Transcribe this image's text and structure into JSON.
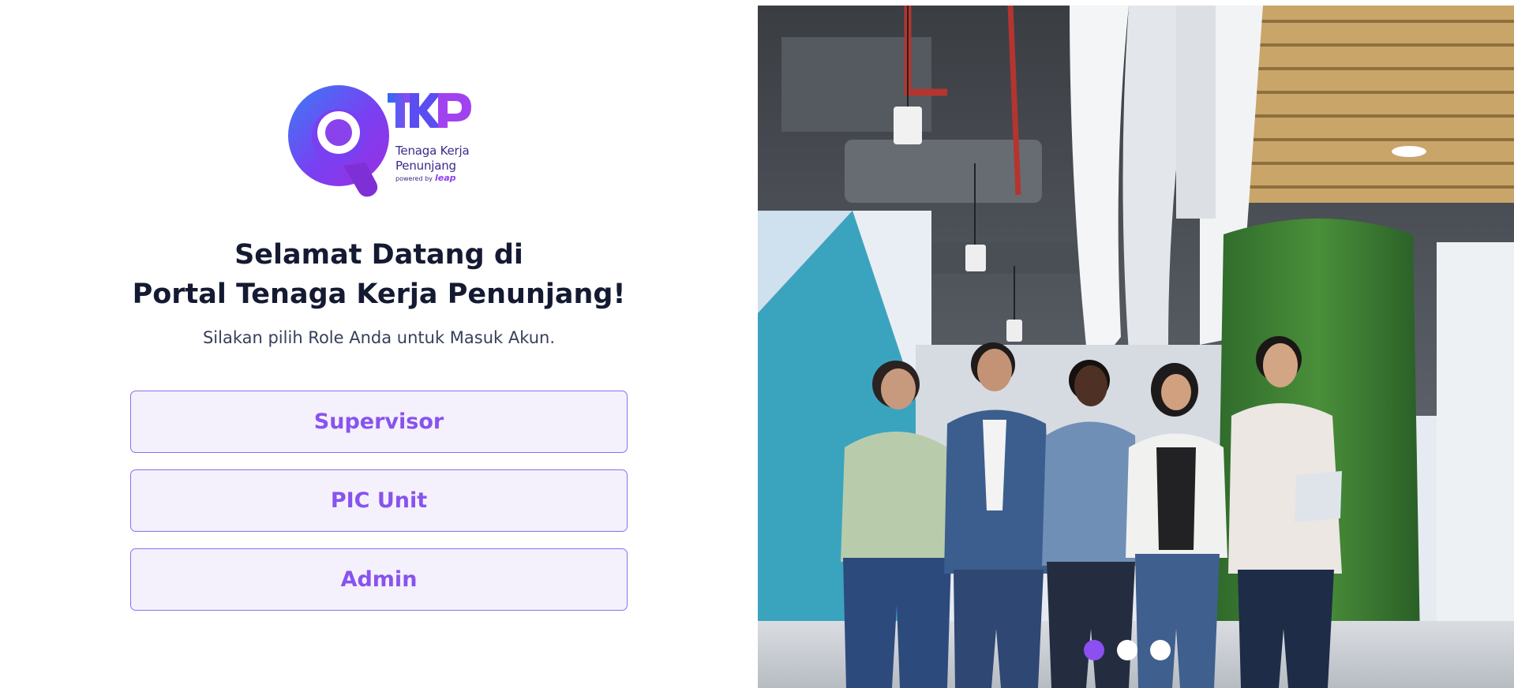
{
  "logo": {
    "mark": "TKP",
    "line1": "Tenaga Kerja",
    "line2": "Penunjang",
    "powered_by": "powered by",
    "partner": "leap"
  },
  "heading": {
    "line1": "Selamat Datang di",
    "line2": "Portal Tenaga Kerja Penunjang!",
    "subtitle": "Silakan pilih Role Anda untuk Masuk Akun."
  },
  "roles": [
    {
      "label": "Supervisor"
    },
    {
      "label": "PIC Unit"
    },
    {
      "label": "Admin"
    }
  ],
  "carousel": {
    "slide_count": 3,
    "active_index": 0,
    "image": "office-team-photo"
  },
  "colors": {
    "primary": "#8853ee",
    "button_bg": "#f4f1fd",
    "button_border": "#8f6cf3",
    "heading": "#151a33",
    "dot_active": "#8b4ff2",
    "dot_inactive": "#ffffff"
  }
}
